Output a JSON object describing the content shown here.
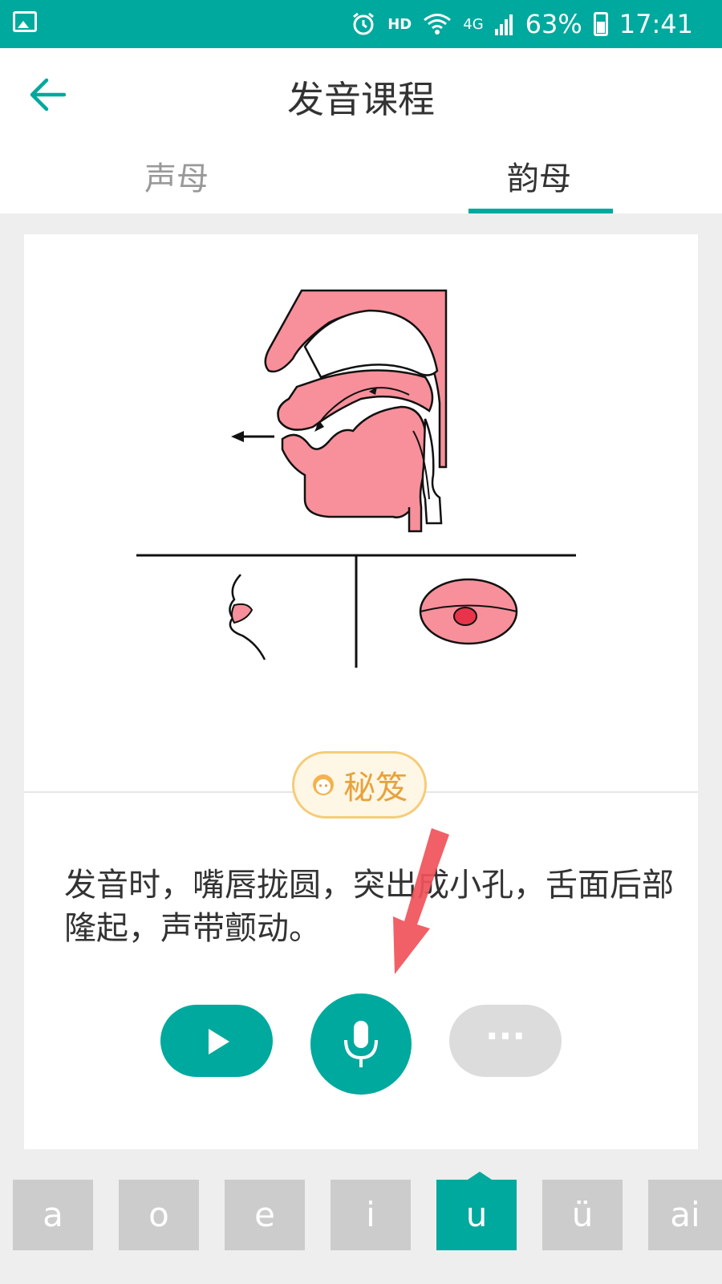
{
  "status_bar": {
    "hd": "HD",
    "network": "4G",
    "battery": "63%",
    "time": "17:41"
  },
  "header": {
    "title": "发音课程"
  },
  "tabs": [
    {
      "label": "声母"
    },
    {
      "label": "韵母"
    }
  ],
  "tips_button": {
    "label": "秘笈"
  },
  "description": "发音时，嘴唇拢圆，突出成小孔，舌面后部隆起，声带颤动。",
  "more_button": {
    "label": "···"
  },
  "letters": [
    {
      "label": "a"
    },
    {
      "label": "o"
    },
    {
      "label": "e"
    },
    {
      "label": "i"
    },
    {
      "label": "u"
    },
    {
      "label": "ü"
    },
    {
      "label": "ai"
    }
  ],
  "active_letter": "u",
  "colors": {
    "accent": "#00a99d",
    "tips": "#e8a23c",
    "illustration": "#f7909a"
  }
}
